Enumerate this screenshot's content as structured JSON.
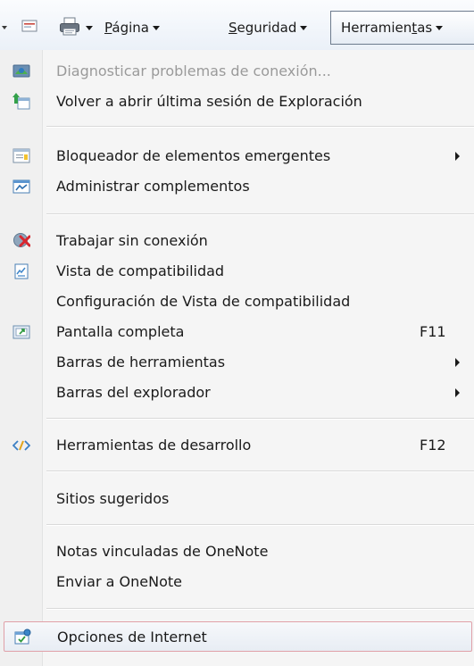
{
  "commandbar": {
    "page_label": "Página",
    "page_accel": "P",
    "page_rest": "ágina",
    "security_accel": "S",
    "security_rest": "eguridad",
    "tools_pre": "Herramien",
    "tools_accel": "t",
    "tools_post": "as"
  },
  "menu": {
    "items": [
      {
        "label": "Diagnosticar problemas de conexión...",
        "icon": "diagnose-connection-icon",
        "disabled": true
      },
      {
        "label": "Volver a abrir última sesión de Exploración",
        "icon": "reopen-session-icon"
      },
      {
        "label": "Bloqueador de elementos emergentes",
        "icon": "popup-blocker-icon",
        "submenu": true
      },
      {
        "label": "Administrar complementos",
        "icon": "manage-addons-icon"
      },
      {
        "label": "Trabajar sin conexión",
        "icon": "work-offline-icon"
      },
      {
        "label": "Vista de compatibilidad",
        "icon": "compatibility-view-icon"
      },
      {
        "label": "Configuración de Vista de compatibilidad"
      },
      {
        "label": "Pantalla completa",
        "icon": "fullscreen-icon",
        "shortcut": "F11"
      },
      {
        "label": "Barras de herramientas",
        "submenu": true
      },
      {
        "label": "Barras del explorador",
        "submenu": true
      },
      {
        "label": "Herramientas de desarrollo",
        "icon": "developer-tools-icon",
        "shortcut": "F12"
      },
      {
        "label": "Sitios sugeridos"
      },
      {
        "label": "Notas vinculadas de OneNote"
      },
      {
        "label": "Enviar a OneNote"
      },
      {
        "label": "Opciones de Internet",
        "icon": "internet-options-icon",
        "selected": true
      }
    ]
  },
  "colors": {
    "menu_bg": "#f5f5f5",
    "selection_border": "#e0a0a8",
    "disabled_text": "#9a9a9a"
  }
}
